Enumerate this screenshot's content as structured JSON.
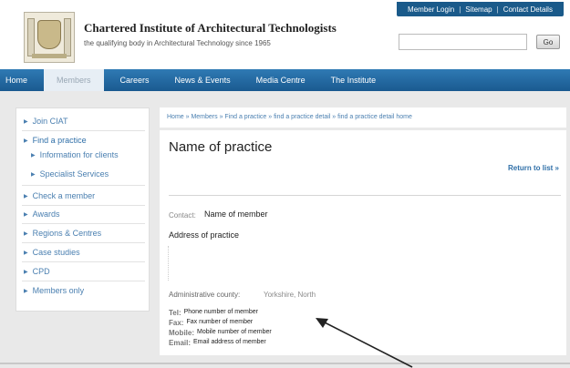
{
  "header": {
    "org_name": "Chartered Institute of Architectural Technologists",
    "tagline": "the qualifying body in Architectural Technology since 1965",
    "util_links": [
      "Member Login",
      "Sitemap",
      "Contact Details"
    ],
    "search_placeholder": "",
    "search_button": "Go"
  },
  "nav": {
    "items": [
      "Home",
      "Members",
      "Careers",
      "News & Events",
      "Media Centre",
      "The Institute"
    ]
  },
  "sidebar": {
    "items": [
      "Join CIAT",
      "Find a practice",
      "Information for clients",
      "Specialist Services",
      "Check a member",
      "Awards",
      "Regions & Centres",
      "Case studies",
      "CPD",
      "Members only"
    ]
  },
  "breadcrumb": "Home » Members » Find a practice » find a practice detail » find a practice detail home",
  "main": {
    "title": "Name of practice",
    "return_link": "Return to list »",
    "contact_label": "Contact:",
    "contact_value": "Name of member",
    "address": "Address of practice",
    "county_label": "Administrative county:",
    "county_value": "Yorkshire, North",
    "tel_label": "Tel:",
    "tel_value": "Phone number of member",
    "fax_label": "Fax:",
    "fax_value": "Fax number of member",
    "mobile_label": "Mobile:",
    "mobile_value": "Mobile number of member",
    "email_label": "Email:",
    "email_value": "Email address of member"
  },
  "colors": {
    "nav_blue": "#1a5a90",
    "link_blue": "#4a7fb0",
    "page_bg": "#e9e9e9"
  }
}
